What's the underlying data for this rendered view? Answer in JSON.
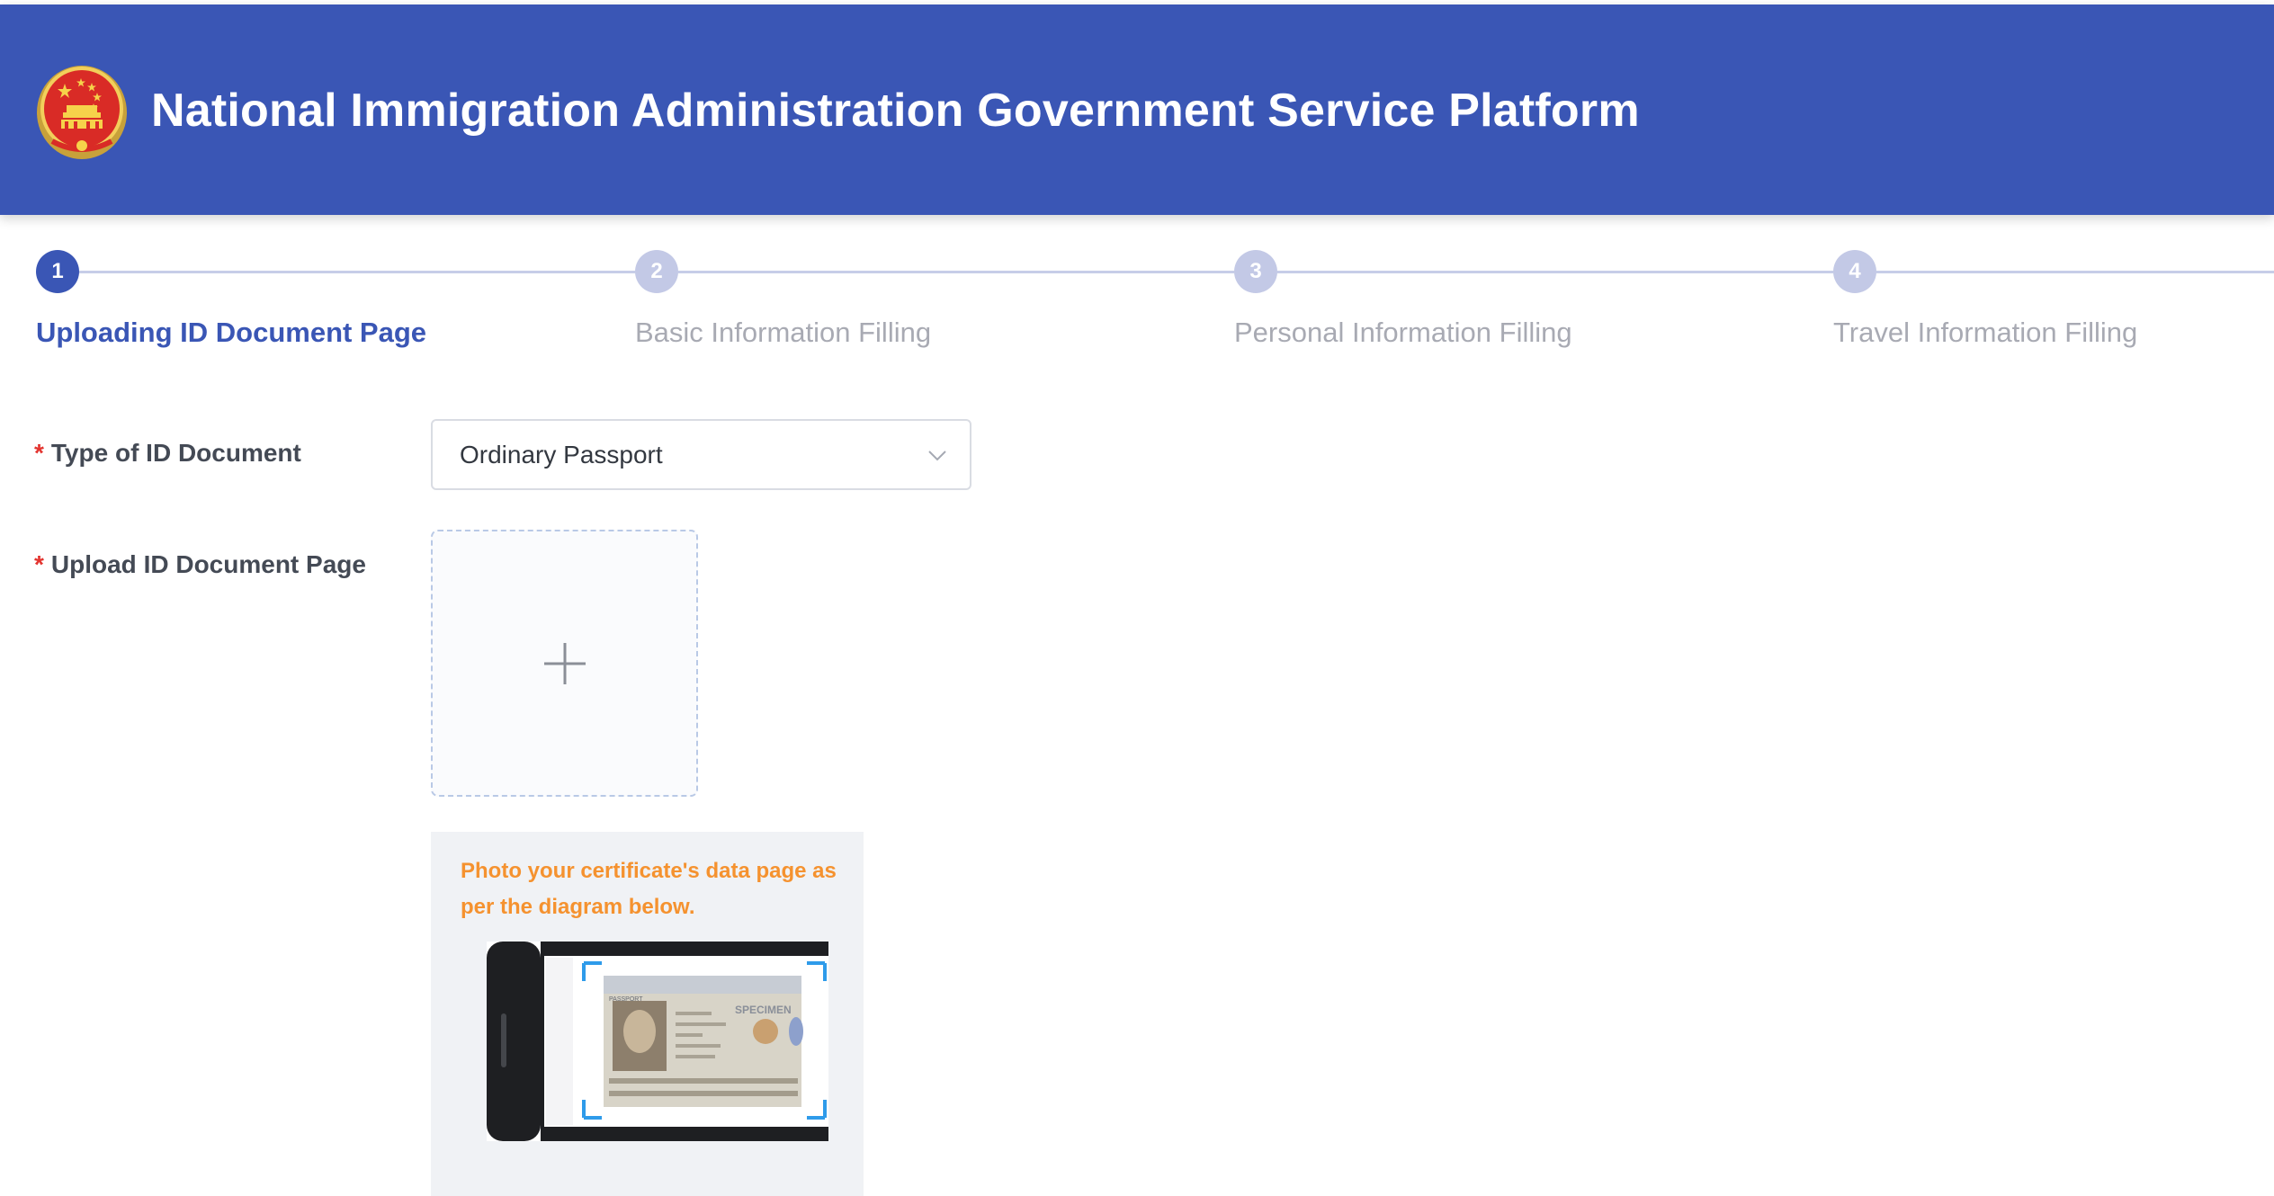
{
  "header": {
    "title": "National Immigration Administration Government Service Platform",
    "brand_color": "#3a56b5"
  },
  "steps": [
    {
      "number": "1",
      "label": "Uploading ID Document Page",
      "state": "active"
    },
    {
      "number": "2",
      "label": "Basic Information Filling",
      "state": "inactive"
    },
    {
      "number": "3",
      "label": "Personal Information Filling",
      "state": "inactive"
    },
    {
      "number": "4",
      "label": "Travel Information Filling",
      "state": "inactive"
    }
  ],
  "form": {
    "required_mark": "*",
    "doc_type": {
      "label": "Type of ID Document",
      "value": "Ordinary Passport"
    },
    "upload": {
      "label": "Upload ID Document Page",
      "icon": "plus-icon"
    },
    "hint": {
      "text": "Photo your certificate's data page as per the diagram below.",
      "diagram_label": "SPECIMEN",
      "diagram_doc_label": "PASSPORT",
      "text_color": "#f5922f"
    }
  }
}
